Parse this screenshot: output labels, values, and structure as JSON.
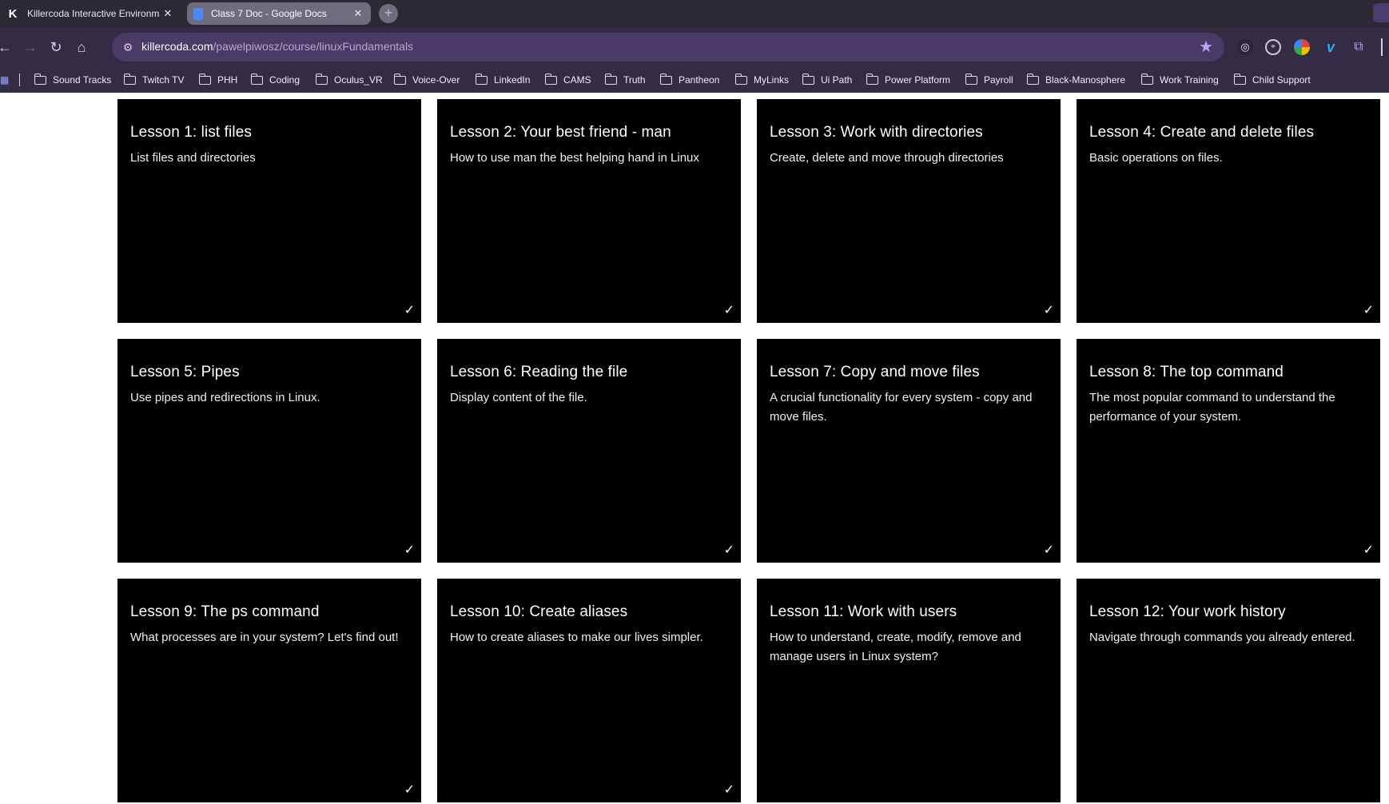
{
  "browser": {
    "tabs": [
      {
        "title": "Killercoda Interactive Environm",
        "favicon": "K",
        "close": "✕",
        "active": true
      },
      {
        "title": "Class 7 Doc - Google Docs",
        "favicon": "docs-icon",
        "close": "✕",
        "active": false
      }
    ],
    "new_tab": "+",
    "url": {
      "host": "killercoda.com",
      "path": "/pawelpiwosz/course/linuxFundamentals"
    },
    "bookmarks": [
      "Sound Tracks",
      "Twitch TV",
      "PHH",
      "Coding",
      "Oculus_VR",
      "Voice-Over",
      "LinkedIn",
      "CAMS",
      "Truth",
      "Pantheon",
      "MyLinks",
      "Ui Path",
      "Power Platform",
      "Payroll",
      "Black-Manosphere",
      "Work Training",
      "Child Support"
    ]
  },
  "lessons": [
    {
      "title": "Lesson 1: list files",
      "description": "List files and directories",
      "completed": true,
      "check": "✓"
    },
    {
      "title": "Lesson 2: Your best friend - man",
      "description": "How to use man the best helping hand in Linux",
      "completed": true,
      "check": "✓"
    },
    {
      "title": "Lesson 3: Work with directories",
      "description": "Create, delete and move through directories",
      "completed": true,
      "check": "✓"
    },
    {
      "title": "Lesson 4: Create and delete files",
      "description": "Basic operations on files.",
      "completed": true,
      "check": "✓"
    },
    {
      "title": "Lesson 5: Pipes",
      "description": "Use pipes and redirections in Linux.",
      "completed": true,
      "check": "✓"
    },
    {
      "title": "Lesson 6: Reading the file",
      "description": "Display content of the file.",
      "completed": true,
      "check": "✓"
    },
    {
      "title": "Lesson 7: Copy and move files",
      "description": "A crucial functionality for every system - copy and move files.",
      "completed": true,
      "check": "✓"
    },
    {
      "title": "Lesson 8: The top command",
      "description": "The most popular command to understand the performance of your system.",
      "completed": true,
      "check": "✓"
    },
    {
      "title": "Lesson 9: The ps command",
      "description": "What processes are in your system? Let's find out!",
      "completed": true,
      "check": "✓"
    },
    {
      "title": "Lesson 10: Create aliases",
      "description": "How to create aliases to make our lives simpler.",
      "completed": true,
      "check": "✓"
    },
    {
      "title": "Lesson 11: Work with users",
      "description": "How to understand, create, modify, remove and manage users in Linux system?",
      "completed": false,
      "check": ""
    },
    {
      "title": "Lesson 12: Your work history",
      "description": "Navigate through commands you already entered.",
      "completed": false,
      "check": ""
    }
  ]
}
